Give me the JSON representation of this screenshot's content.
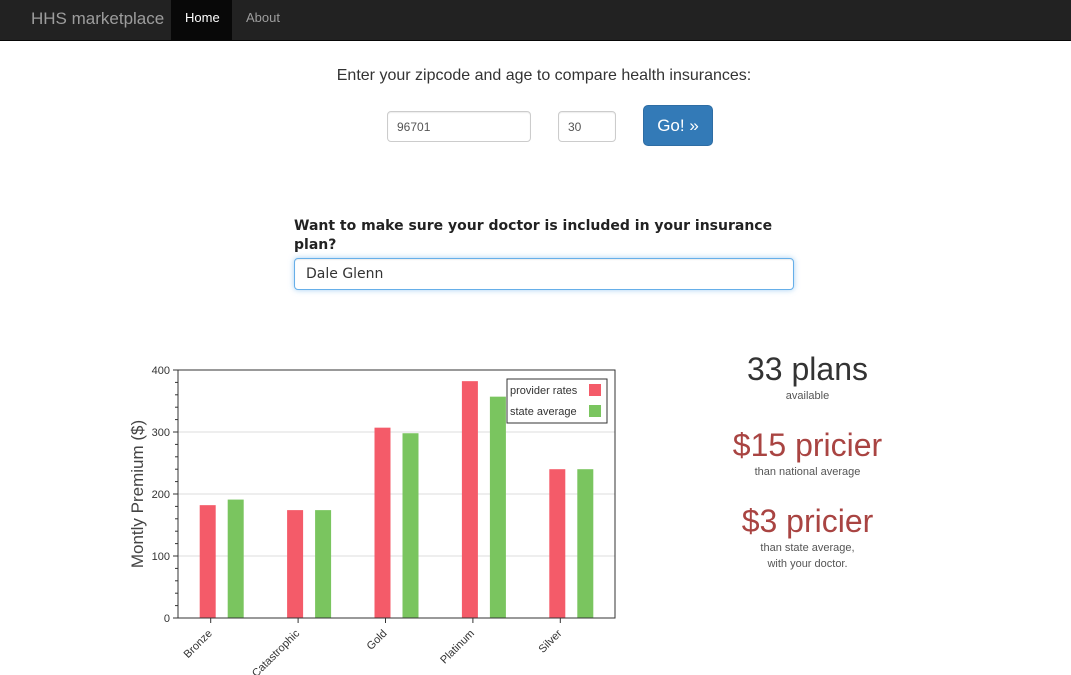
{
  "navbar": {
    "brand": "HHS marketplace",
    "items": [
      {
        "label": "Home",
        "active": true
      },
      {
        "label": "About",
        "active": false
      }
    ]
  },
  "search": {
    "prompt": "Enter your zipcode and age to compare health insurances:",
    "zipcode": "96701",
    "age": "30",
    "go_label": "Go! »"
  },
  "doctor": {
    "question": "Want to make sure your doctor is included in your insurance plan?",
    "value": "Dale Glenn"
  },
  "stats": {
    "plans_count": "33 plans",
    "plans_sub": "available",
    "national": "$15 pricier",
    "national_sub": "than national average",
    "state": "$3 pricier",
    "state_sub1": "than state average,",
    "state_sub2": "with your doctor."
  },
  "colors": {
    "navbar_bg": "#222222",
    "primary_button": "#337ab7",
    "pricier_text": "#a94442",
    "provider_bar": "#f45b69",
    "state_bar": "#7ac55f"
  },
  "chart_data": {
    "type": "bar",
    "title": "",
    "xlabel": "",
    "ylabel": "Montly Premium ($)",
    "ylim": [
      0,
      400
    ],
    "yticks": [
      0,
      100,
      200,
      300,
      400
    ],
    "grid": true,
    "legend_position": "top-right",
    "categories": [
      "Bronze",
      "Catastrophic",
      "Gold",
      "Platinum",
      "Silver"
    ],
    "series": [
      {
        "name": "provider rates",
        "color": "#f45b69",
        "values": [
          182,
          174,
          307,
          382,
          240
        ]
      },
      {
        "name": "state average",
        "color": "#7ac55f",
        "values": [
          191,
          174,
          298,
          357,
          240
        ]
      }
    ]
  }
}
